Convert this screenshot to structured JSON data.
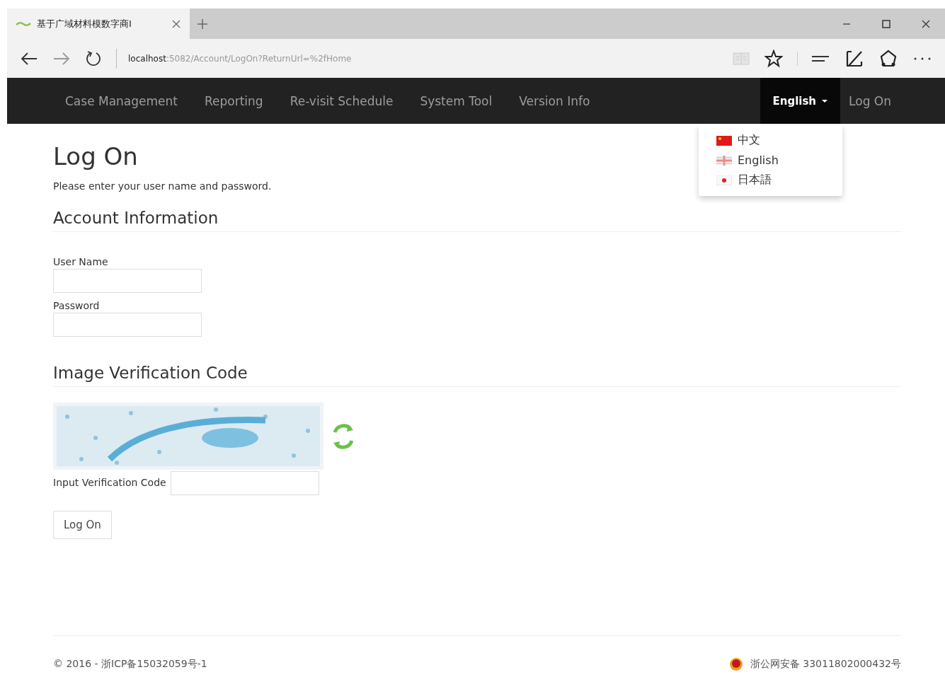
{
  "browser": {
    "tabs": [
      {
        "title": "基于广域材料模数字商I",
        "selected": true
      }
    ],
    "address": {
      "host": "localhost",
      "path": ":5082/Account/LogOn?ReturnUrl=%2fHome"
    }
  },
  "navbar": {
    "items": [
      {
        "label": "Case Management"
      },
      {
        "label": "Reporting"
      },
      {
        "label": "Re-visit Schedule"
      },
      {
        "label": "System Tool"
      },
      {
        "label": "Version Info"
      }
    ],
    "language": {
      "label": "English",
      "expanded": true,
      "options": [
        {
          "label": "中文",
          "kind": "cn"
        },
        {
          "label": "English",
          "kind": "uk"
        },
        {
          "label": "日本語",
          "kind": "jp"
        }
      ]
    },
    "login_link": "Log On"
  },
  "page": {
    "title": "Log On",
    "intro": "Please enter your user name and password.",
    "account_heading": "Account Information",
    "fields": [
      {
        "label": "User Name"
      },
      {
        "label": "Password"
      }
    ],
    "captcha_heading": "Image Verification Code",
    "captcha": {
      "kind": "picture",
      "input_label": "Input Verification Code"
    },
    "submit": "Log On"
  },
  "footer": {
    "copyright": "© 2016 - 浙ICP备15032059号-1",
    "police": "浙公网安备 33011802000432号"
  }
}
